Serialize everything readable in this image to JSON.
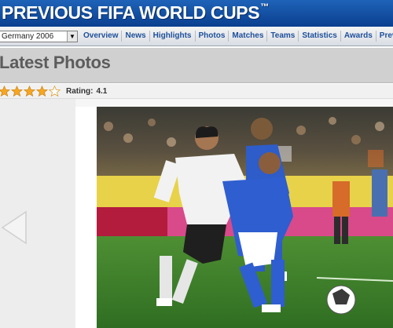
{
  "header": {
    "title": "PREVIOUS FIFA WORLD CUPS",
    "trademark": "™"
  },
  "nav": {
    "tournament_select": {
      "selected": "Germany 2006"
    },
    "links": [
      "Overview",
      "News",
      "Highlights",
      "Photos",
      "Matches",
      "Teams",
      "Statistics",
      "Awards",
      "Previ"
    ]
  },
  "section": {
    "title": "Latest Photos"
  },
  "rating": {
    "label": "Rating:",
    "value": "4.1",
    "stars_filled": 4,
    "stars_total": 5
  },
  "viewer": {
    "prev_icon": "chevron-left-icon"
  },
  "colors": {
    "banner": "#1459b0",
    "nav_link": "#1d4f9a",
    "star": "#f5a623",
    "section_bg": "#d0d0d0",
    "pitch": "#3a7a2a"
  }
}
